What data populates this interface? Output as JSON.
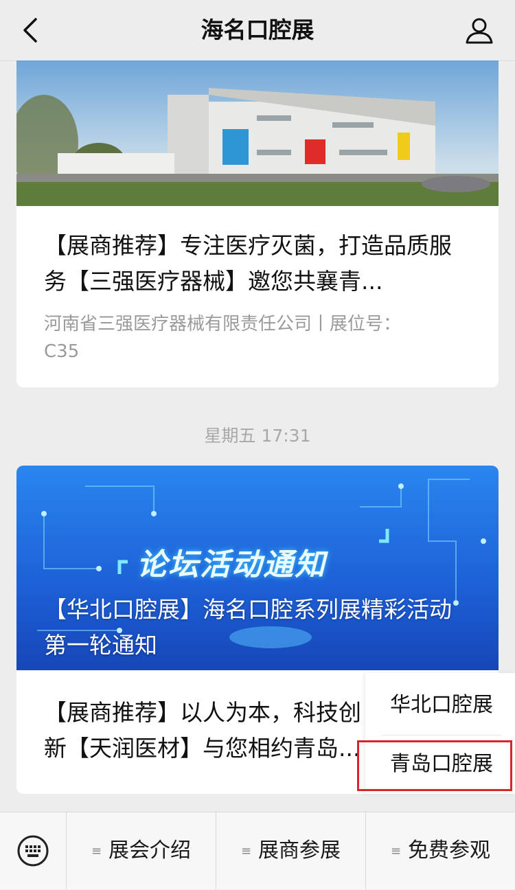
{
  "nav": {
    "title": "海名口腔展",
    "back_icon": "chevron-left-icon",
    "profile_icon": "person-icon"
  },
  "articles": [
    {
      "title": "【展商推荐】专注医疗灭菌，打造品质服务【三强医疗器械】邀您共襄青...",
      "subtitle": "河南省三强医疗器械有限责任公司丨展位号：C35"
    },
    {
      "cover_text": "【华北口腔展】海名口腔系列展精彩活动第一轮通知",
      "cover_banner": "论坛活动通知",
      "title": "【展商推荐】以人为本，科技创新【天润医材】与您相约青岛..."
    }
  ],
  "timestamp": "星期五 17:31",
  "popup_menu": {
    "items": [
      "华北口腔展",
      "青岛口腔展"
    ],
    "highlighted": "青岛口腔展"
  },
  "bottom_menu": {
    "keyboard_icon": "keyboard-icon",
    "items": [
      "展会介绍",
      "展商参展",
      "免费参观"
    ],
    "item_icon": "menu-lines-icon"
  },
  "colors": {
    "background": "#ededed",
    "highlight_border": "#d9252a",
    "banner_blue": "#1f6fe0"
  }
}
